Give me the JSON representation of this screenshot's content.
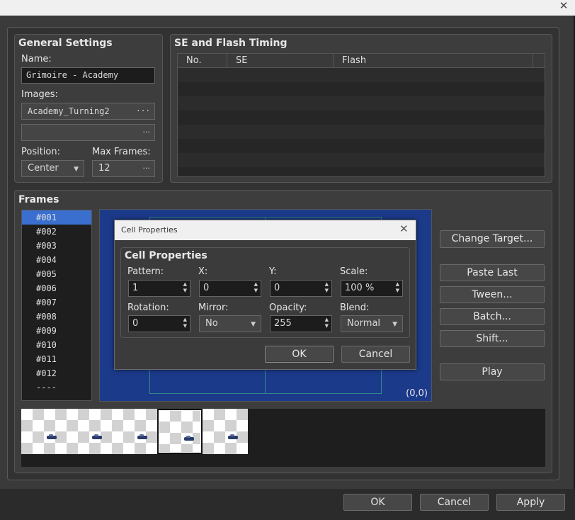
{
  "window": {
    "close_glyph": "✕"
  },
  "general": {
    "header": "General Settings",
    "name_label": "Name:",
    "name_value": "Grimoire - Academy",
    "images_label": "Images:",
    "image1": "Academy_Turning2",
    "image2": "",
    "browse_glyph": "···",
    "position_label": "Position:",
    "position_value": "Center",
    "max_frames_label": "Max Frames:",
    "max_frames_value": "12"
  },
  "timing": {
    "header": "SE and Flash Timing",
    "columns": [
      "No.",
      "SE",
      "Flash"
    ]
  },
  "frames": {
    "header": "Frames",
    "items": [
      "#001",
      "#002",
      "#003",
      "#004",
      "#005",
      "#006",
      "#007",
      "#008",
      "#009",
      "#010",
      "#011",
      "#012",
      "----"
    ],
    "selected_index": 0
  },
  "preview": {
    "coord": "(0,0)"
  },
  "side_buttons": {
    "change_target": "Change Target...",
    "paste_last": "Paste Last",
    "tween": "Tween...",
    "batch": "Batch...",
    "shift": "Shift...",
    "play": "Play"
  },
  "thumbnails": {
    "count": 5,
    "selected_index": 3
  },
  "dialog": {
    "title": "Cell Properties",
    "group_header": "Cell Properties",
    "pattern_label": "Pattern:",
    "pattern_value": "1",
    "x_label": "X:",
    "x_value": "0",
    "y_label": "Y:",
    "y_value": "0",
    "scale_label": "Scale:",
    "scale_value": "100 %",
    "rotation_label": "Rotation:",
    "rotation_value": "0",
    "mirror_label": "Mirror:",
    "mirror_value": "No",
    "opacity_label": "Opacity:",
    "opacity_value": "255",
    "blend_label": "Blend:",
    "blend_value": "Normal",
    "ok": "OK",
    "cancel": "Cancel"
  },
  "footer": {
    "ok": "OK",
    "cancel": "Cancel",
    "apply": "Apply"
  },
  "colors": {
    "preview_bg": "#1c3a8a",
    "selected_frame": "#3a6fd0",
    "dark_bg": "#1e1e1e"
  }
}
